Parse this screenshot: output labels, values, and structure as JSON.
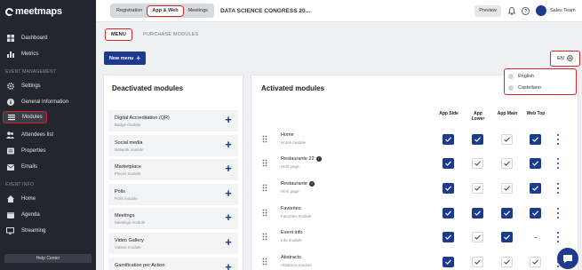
{
  "brand": {
    "name": "meetmaps"
  },
  "sidebar": {
    "sections": [
      {
        "label": ""
      },
      {
        "label": "EVENT MANAGEMENT"
      },
      {
        "label": "EVENT INFO"
      }
    ],
    "items": [
      {
        "label": "Dashboard",
        "icon": "dashboard-icon"
      },
      {
        "label": "Metrics",
        "icon": "bar-chart-icon"
      },
      {
        "label": "Settings",
        "icon": "gear-icon"
      },
      {
        "label": "General Information",
        "icon": "info-icon"
      },
      {
        "label": "Modules",
        "icon": "list-icon",
        "active": true
      },
      {
        "label": "Attendees list",
        "icon": "users-icon"
      },
      {
        "label": "Properties",
        "icon": "tag-icon"
      },
      {
        "label": "Emails",
        "icon": "mail-icon"
      },
      {
        "label": "Home",
        "icon": "home-icon"
      },
      {
        "label": "Agenda",
        "icon": "calendar-icon"
      },
      {
        "label": "Streaming",
        "icon": "screen-icon"
      }
    ],
    "help": "Help Center"
  },
  "topbar": {
    "tabs": [
      {
        "label": "Registration"
      },
      {
        "label": "App & Web",
        "selected": true
      },
      {
        "label": "Meetings"
      }
    ],
    "event_title": "DATA SCIENCE CONGRESS 20...",
    "preview": "Preview",
    "team": "Sales Team"
  },
  "subtabs": [
    {
      "label": "MENU",
      "selected": true
    },
    {
      "label": "PURCHASE MODULES"
    }
  ],
  "new_menu": "New menu",
  "language": {
    "current": "EN",
    "options": [
      "English",
      "Castellano"
    ]
  },
  "deactivated": {
    "title": "Deactivated modules",
    "modules": [
      {
        "name": "Digital Accreditation (QR)",
        "sub": "Badge module"
      },
      {
        "name": "Social media",
        "sub": "Network module"
      },
      {
        "name": "Marketplace",
        "sub": "Places module"
      },
      {
        "name": "Polls",
        "sub": "Polls module"
      },
      {
        "name": "Meetings",
        "sub": "Meetings module"
      },
      {
        "name": "Video Gallery",
        "sub": "Videos module"
      },
      {
        "name": "Gamification per Action",
        "sub": ""
      }
    ]
  },
  "activated": {
    "title": "Activated modules",
    "columns": [
      "App Side",
      "App Lower",
      "App Main",
      "Web Top"
    ],
    "modules": [
      {
        "name": "Home",
        "sub": "Home module",
        "info": false,
        "checks": [
          "on",
          "on",
          "off",
          "on"
        ]
      },
      {
        "name": "Restaurante 22",
        "sub": "Html page",
        "info": true,
        "checks": [
          "on",
          "off",
          "off",
          "on"
        ]
      },
      {
        "name": "Restaurante",
        "sub": "Html page",
        "info": true,
        "checks": [
          "on",
          "off",
          "off",
          "on"
        ]
      },
      {
        "name": "Favorites",
        "sub": "Favorites module",
        "info": false,
        "checks": [
          "on",
          "on",
          "on",
          "on"
        ]
      },
      {
        "name": "Event info",
        "sub": "Info module",
        "info": false,
        "checks": [
          "on",
          "off",
          "on",
          "none"
        ]
      },
      {
        "name": "Abstracts",
        "sub": "Abstracts module",
        "info": false,
        "checks": [
          "on",
          "off",
          "off",
          "off"
        ]
      }
    ]
  },
  "colors": {
    "sidebar": "#23262e",
    "accent": "#1d3a8f",
    "highlight": "#d9252a"
  }
}
